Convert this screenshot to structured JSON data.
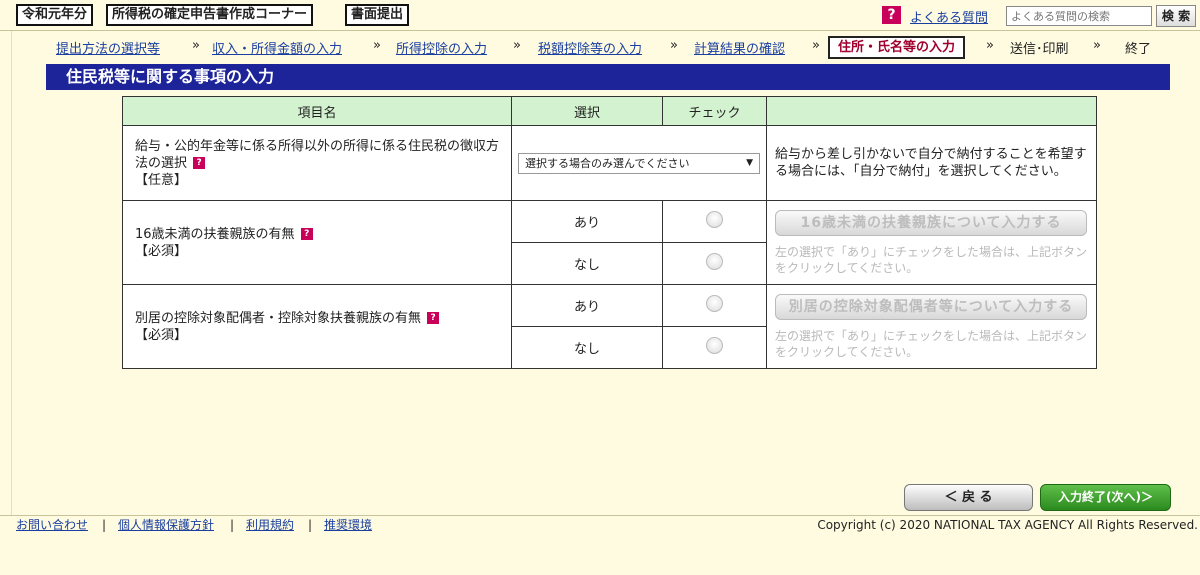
{
  "header": {
    "era_tag": "令和元年分",
    "corner_tag": "所得税の確定申告書作成コーナー",
    "mode_tag": "書面提出",
    "faq_link": "よくある質問",
    "search_placeholder": "よくある質問の検索",
    "search_button": "検 索"
  },
  "breadcrumb": {
    "steps": [
      "提出方法の選択等",
      "収入・所得金額の入力",
      "所得控除の入力",
      "税額控除等の入力",
      "計算結果の確認",
      "住所・氏名等の入力",
      "送信･印刷",
      "終了"
    ],
    "separator": "»"
  },
  "page_title": "住民税等に関する事項の入力",
  "table": {
    "headers": [
      "項目名",
      "選択",
      "チェック",
      ""
    ],
    "row1": {
      "label": "給与・公的年金等に係る所得以外の所得に係る住民税の徴収方法の選択",
      "requirement": "【任意】",
      "select_value": "選択する場合のみ選んでください",
      "note": "給与から差し引かないで自分で納付することを希望する場合には、「自分で納付」を選択してください。"
    },
    "row2": {
      "label": "16歳未満の扶養親族の有無",
      "requirement": "【必須】",
      "opt_yes": "あり",
      "opt_no": "なし",
      "button": "16歳未満の扶養親族について入力する",
      "note": "左の選択で「あり」にチェックをした場合は、上記ボタンをクリックしてください。"
    },
    "row3": {
      "label": "別居の控除対象配偶者・控除対象扶養親族の有無",
      "requirement": "【必須】",
      "opt_yes": "あり",
      "opt_no": "なし",
      "button": "別居の控除対象配偶者等について入力する",
      "note": "左の選択で「あり」にチェックをした場合は、上記ボタンをクリックしてください。"
    },
    "help_icon_glyph": "?"
  },
  "nav": {
    "back": "＜ 戻 る",
    "next": "入力終了(次へ)＞"
  },
  "footer": {
    "links": [
      "お問い合わせ",
      "個人情報保護方針",
      "利用規約",
      "推奨環境"
    ],
    "separator": "|",
    "copyright": "Copyright (c) 2020 NATIONAL TAX AGENCY All Rights Reserved."
  },
  "colors": {
    "title_bar": "#1d2398",
    "table_header": "#d3f2cf",
    "current_step": "#a0002d",
    "help_icon": "#c8005a",
    "next_button": "#2b8a1e",
    "background": "#fffbe0"
  }
}
